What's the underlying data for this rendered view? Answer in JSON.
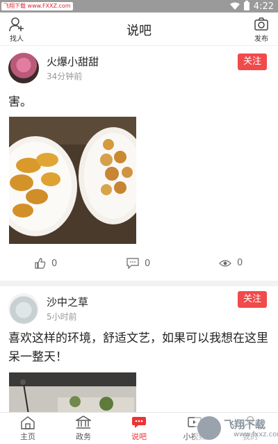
{
  "status_bar": {
    "badge": "飞翔下载 www.FXXZ.com",
    "time": "4:22"
  },
  "header": {
    "left_label": "找人",
    "title": "说吧",
    "right_label": "发布"
  },
  "posts": [
    {
      "user": "火爆小甜甜",
      "time": "34分钟前",
      "follow_label": "关注",
      "text": "害。",
      "likes": "0",
      "comments": "0",
      "views": "0"
    },
    {
      "user": "沙中之草",
      "time": "5小时前",
      "follow_label": "关注",
      "text": "喜欢这样的环境，舒适文艺，如果可以我想在这里呆一整天！"
    }
  ],
  "tabs": [
    {
      "label": "主页",
      "icon": "home-icon",
      "active": false
    },
    {
      "label": "政务",
      "icon": "government-building-icon",
      "active": false
    },
    {
      "label": "说吧",
      "icon": "chat-bubble-icon",
      "active": true
    },
    {
      "label": "小视频",
      "icon": "video-icon",
      "active": false
    },
    {
      "label": "我的",
      "icon": "profile-icon",
      "active": false
    }
  ],
  "watermark": {
    "text": "飞翔下载",
    "url": "www.fxxz.com"
  },
  "colors": {
    "accent": "#f04a4a",
    "status_bar": "#9a9a9a"
  }
}
